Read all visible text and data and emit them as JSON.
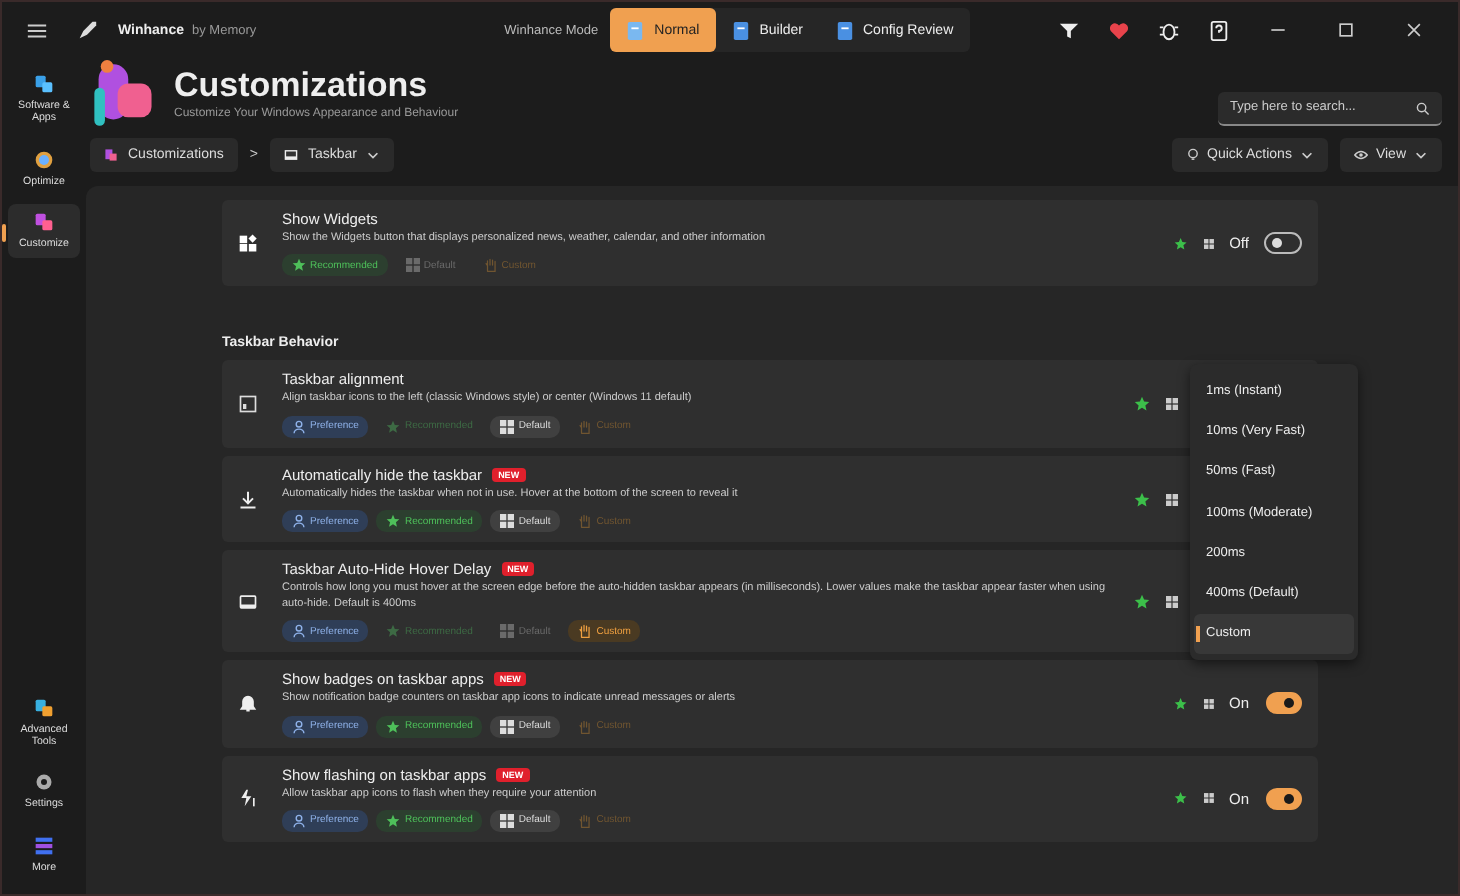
{
  "titlebar": {
    "app_name": "Winhance",
    "app_by": "by Memory",
    "mode_label": "Winhance Mode",
    "modes": [
      {
        "label": "Normal",
        "selected": true
      },
      {
        "label": "Builder",
        "selected": false
      },
      {
        "label": "Config Review",
        "selected": false
      }
    ]
  },
  "sidebar": {
    "items": [
      {
        "label": "Software & Apps",
        "selected": false
      },
      {
        "label": "Optimize",
        "selected": false
      },
      {
        "label": "Customize",
        "selected": true
      }
    ],
    "bottom_items": [
      {
        "label": "Advanced Tools"
      },
      {
        "label": "Settings"
      },
      {
        "label": "More"
      }
    ]
  },
  "header": {
    "title": "Customizations",
    "subtitle": "Customize Your Windows Appearance and Behaviour",
    "search": {
      "placeholder": "Type here to search..."
    }
  },
  "breadcrumb": {
    "root": "Customizations",
    "separator": ">",
    "current": "Taskbar"
  },
  "actions": [
    "Quick Actions",
    "View"
  ],
  "settings": [
    {
      "title": "Show Widgets",
      "description": "Show the Widgets button that displays personalized news, weather, calendar, and other information",
      "chips": [
        {
          "kind": "recommended",
          "label": "Recommended",
          "active": true
        },
        {
          "kind": "default",
          "label": "Default",
          "active": false
        },
        {
          "kind": "custom",
          "label": "Custom",
          "active": false
        }
      ],
      "toggle": {
        "on": false,
        "label": "Off"
      }
    }
  ],
  "section": {
    "title": "Taskbar Behavior",
    "settings": [
      {
        "title": "Taskbar alignment",
        "description": "Align taskbar icons to the left (classic Windows style) or center (Windows 11 default)",
        "chips": [
          {
            "kind": "preference",
            "label": "Preference",
            "active": true
          },
          {
            "kind": "recommended",
            "label": "Recommended",
            "active": false
          },
          {
            "kind": "default",
            "label": "Default",
            "active": true
          },
          {
            "kind": "custom",
            "label": "Custom",
            "active": false
          }
        ]
      },
      {
        "title": "Automatically hide the taskbar",
        "new_label": "NEW",
        "description": "Automatically hides the taskbar when not in use. Hover at the bottom of the screen to reveal it",
        "chips": [
          {
            "kind": "preference",
            "label": "Preference",
            "active": true
          },
          {
            "kind": "recommended",
            "label": "Recommended",
            "active": true
          },
          {
            "kind": "default",
            "label": "Default",
            "active": true
          },
          {
            "kind": "custom",
            "label": "Custom",
            "active": false
          }
        ]
      },
      {
        "title": "Taskbar Auto-Hide Hover Delay",
        "new_label": "NEW",
        "description": "Controls how long you must hover at the screen edge before the auto-hidden taskbar appears (in milliseconds). Lower values make the taskbar appear faster when using auto-hide. Default is 400ms",
        "chips": [
          {
            "kind": "preference",
            "label": "Preference",
            "active": true
          },
          {
            "kind": "recommended",
            "label": "Recommended",
            "active": false
          },
          {
            "kind": "default",
            "label": "Default",
            "active": false
          },
          {
            "kind": "custom",
            "label": "Custom",
            "active": true
          }
        ]
      },
      {
        "title": "Show badges on taskbar apps",
        "new_label": "NEW",
        "description": "Show notification badge counters on taskbar app icons to indicate unread messages or alerts",
        "chips": [
          {
            "kind": "preference",
            "label": "Preference",
            "active": true
          },
          {
            "kind": "recommended",
            "label": "Recommended",
            "active": true
          },
          {
            "kind": "default",
            "label": "Default",
            "active": true
          },
          {
            "kind": "custom",
            "label": "Custom",
            "active": false
          }
        ],
        "toggle": {
          "on": true,
          "label": "On"
        }
      },
      {
        "title": "Show flashing on taskbar apps",
        "new_label": "NEW",
        "description": "Allow taskbar app icons to flash when they require your attention",
        "chips": [
          {
            "kind": "preference",
            "label": "Preference",
            "active": true
          },
          {
            "kind": "recommended",
            "label": "Recommended",
            "active": true
          },
          {
            "kind": "default",
            "label": "Default",
            "active": true
          },
          {
            "kind": "custom",
            "label": "Custom",
            "active": false
          }
        ],
        "toggle": {
          "on": true,
          "label": "On"
        }
      }
    ]
  },
  "dropdown": {
    "items": [
      {
        "label": "1ms (Instant)",
        "selected": false
      },
      {
        "label": "10ms (Very Fast)",
        "selected": false
      },
      {
        "label": "50ms (Fast)",
        "selected": false
      },
      {
        "label": "100ms (Moderate)",
        "selected": false
      },
      {
        "label": "200ms",
        "selected": false
      },
      {
        "label": "400ms (Default)",
        "selected": false
      },
      {
        "label": "Custom",
        "selected": true
      }
    ]
  }
}
